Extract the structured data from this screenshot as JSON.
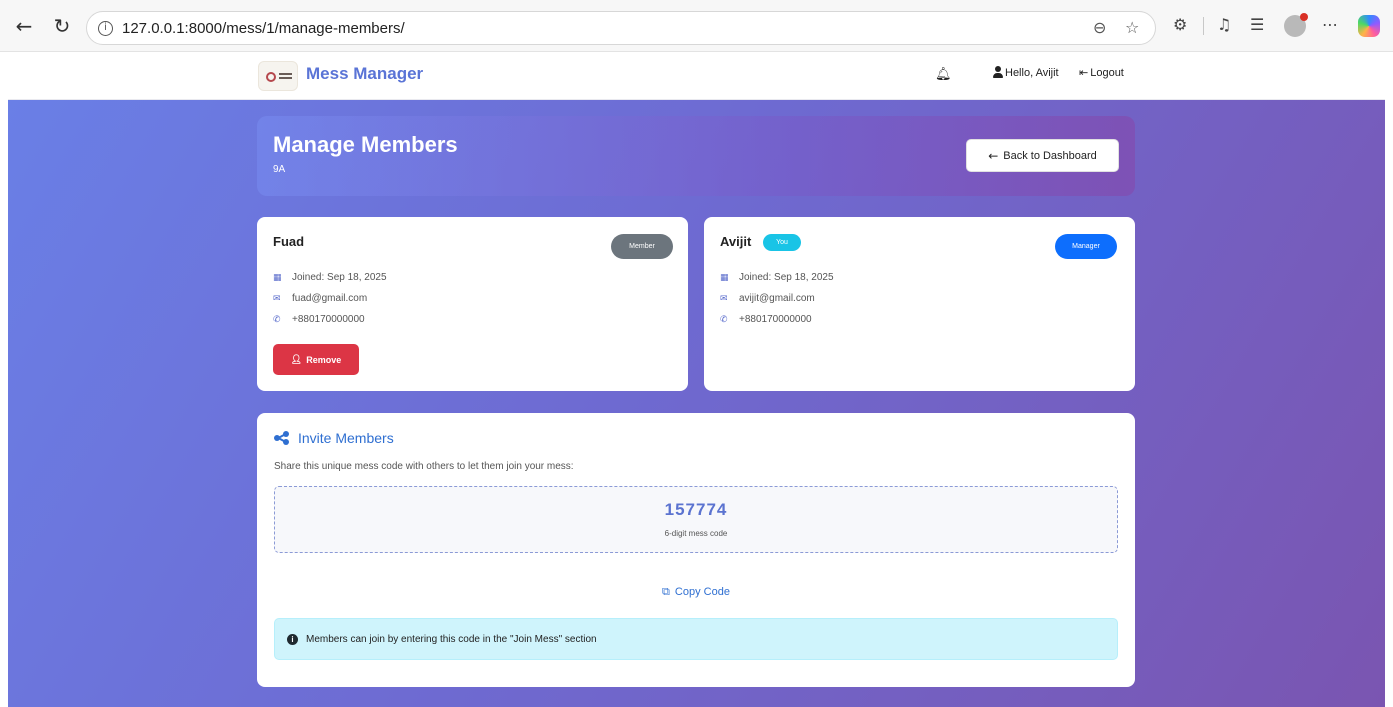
{
  "browser": {
    "url": "127.0.0.1:8000/mess/1/manage-members/"
  },
  "nav": {
    "brand": "Mess Manager",
    "hello": "Hello, Avijit",
    "logout": "Logout"
  },
  "header": {
    "title": "Manage Members",
    "subtitle": "9A",
    "back_label": "Back to Dashboard"
  },
  "members": [
    {
      "name": "Fuad",
      "role": "Member",
      "role_color": "#6c757d",
      "is_you": false,
      "joined": "Joined: Sep 18, 2025",
      "email": "fuad@gmail.com",
      "phone": "+880170000000",
      "remove_label": "Remove"
    },
    {
      "name": "Avijit",
      "role": "Manager",
      "role_color": "#0d6efd",
      "is_you": true,
      "you_label": "You",
      "joined": "Joined: Sep 18, 2025",
      "email": "avijit@gmail.com",
      "phone": "+880170000000"
    }
  ],
  "invite": {
    "title": "Invite Members",
    "description": "Share this unique mess code with others to let them join your mess:",
    "code": "157774",
    "code_label": "6-digit mess code",
    "copy_label": "Copy Code",
    "info": "Members can join by entering this code in the \"Join Mess\" section"
  },
  "colors": {
    "brand": "#5a74d6",
    "danger": "#dc3545",
    "info_bg": "#cff4fc",
    "link": "#2f6fd1"
  }
}
